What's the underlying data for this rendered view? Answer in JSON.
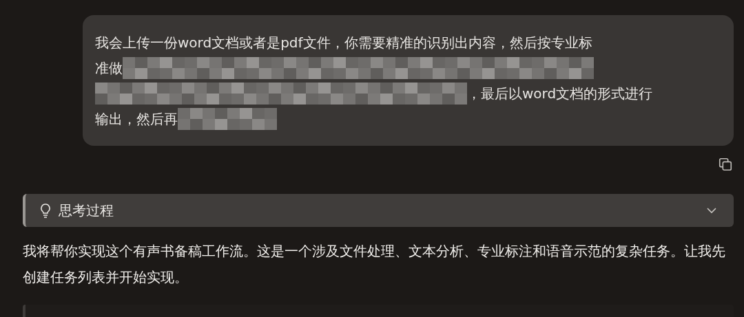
{
  "user_message": {
    "lines": [
      {
        "parts": [
          {
            "kind": "text",
            "text": "我会上传一份word文档或者是pdf文件，你需要精准的识别出内容，然后按专业标"
          }
        ]
      },
      {
        "parts": [
          {
            "kind": "text",
            "text": "准做"
          },
          {
            "kind": "redacted"
          }
        ]
      },
      {
        "parts": [
          {
            "kind": "redacted"
          },
          {
            "kind": "text",
            "text": "，最后以word文档的形式进行"
          }
        ]
      },
      {
        "parts": [
          {
            "kind": "text",
            "text": "输出，然后再"
          },
          {
            "kind": "redacted"
          }
        ]
      }
    ]
  },
  "thinking": {
    "title": "思考过程",
    "expanded": false
  },
  "reply": "我将帮你实现这个有声书备稿工作流。这是一个涉及文件处理、文本分析、专业标注和语音示范的复杂任务。让我先创建任务列表并开始实现。"
}
